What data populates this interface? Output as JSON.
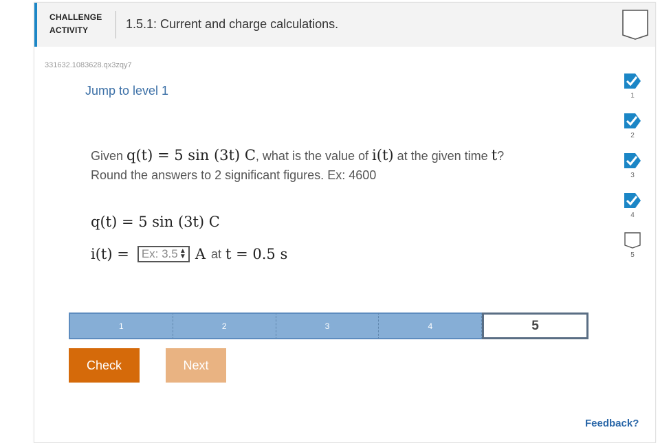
{
  "header": {
    "label_line1": "CHALLENGE",
    "label_line2": "ACTIVITY",
    "title": "1.5.1: Current and charge calculations."
  },
  "ref_id": "331632.1083628.qx3zqy7",
  "jump_link": "Jump to level 1",
  "question": {
    "prefix": "Given",
    "given_expr": "q(t) = 5 sin (3t) C",
    "mid": ", what is the value of",
    "current_expr": "i(t)",
    "after_current": "at the given time",
    "time_var": "t",
    "end": "?",
    "line2": "Round the answers to 2 significant figures. Ex: 4600"
  },
  "equations": {
    "q_expr": "q(t) = 5 sin (3t) C",
    "i_lhs": "i(t) =",
    "answer_placeholder": "Ex: 3.5",
    "unit": "A",
    "at_word": "at",
    "time_expr": "t = 0.5 s"
  },
  "levels": [
    "1",
    "2",
    "3",
    "4",
    "5"
  ],
  "current_level": 5,
  "buttons": {
    "check": "Check",
    "next": "Next"
  },
  "progress": [
    {
      "label": "1",
      "completed": true
    },
    {
      "label": "2",
      "completed": true
    },
    {
      "label": "3",
      "completed": true
    },
    {
      "label": "4",
      "completed": true
    },
    {
      "label": "5",
      "completed": false
    }
  ],
  "feedback": "Feedback?",
  "colors": {
    "accent_blue": "#1b86c6",
    "check_orange": "#d56a0a",
    "next_orange_light": "#e9b382",
    "level_blue": "#86aed6",
    "link_blue": "#3b6fa6"
  }
}
